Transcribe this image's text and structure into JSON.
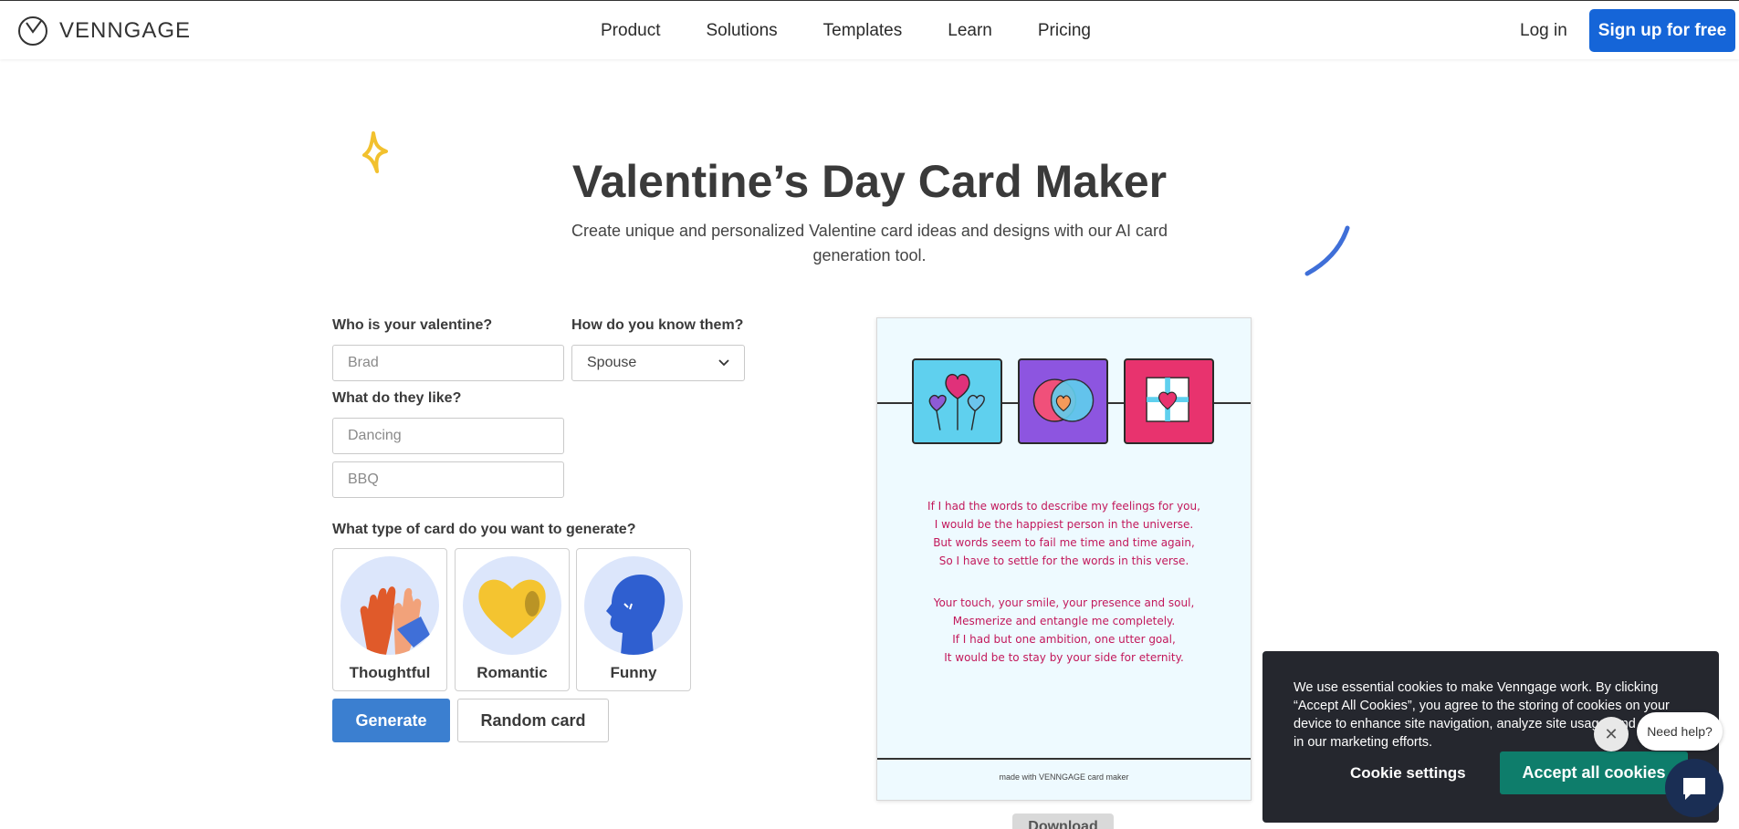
{
  "header": {
    "logo_text": "VENNGAGE",
    "nav": [
      "Product",
      "Solutions",
      "Templates",
      "Learn",
      "Pricing"
    ],
    "login": "Log in",
    "signup": "Sign up for free"
  },
  "hero": {
    "title": "Valentine’s Day Card Maker",
    "subtitle": "Create unique and personalized Valentine card ideas and designs with our AI card generation tool."
  },
  "form": {
    "who_label": "Who is your valentine?",
    "who_placeholder": "Brad",
    "know_label": "How do you know them?",
    "know_value": "Spouse",
    "like_label": "What do they like?",
    "like_placeholder_1": "Dancing",
    "like_placeholder_2": "BBQ",
    "type_label": "What type of card do you want to generate?",
    "types": [
      {
        "label": "Thoughtful",
        "icon": "high-five-icon"
      },
      {
        "label": "Romantic",
        "icon": "heart-icon"
      },
      {
        "label": "Funny",
        "icon": "head-icon"
      }
    ],
    "generate": "Generate",
    "random": "Random card"
  },
  "card": {
    "stanza1": [
      "If I had the words to describe my feelings for you,",
      "I would be the happiest person in the universe.",
      "But words seem to fail me time and time again,",
      "So I have to settle for the words in this verse."
    ],
    "stanza2": [
      "Your touch, your smile, your presence and soul,",
      "Mesmerize and entangle me completely.",
      "If I had but one ambition, one utter goal,",
      "It would be to stay by your side for eternity."
    ],
    "footer": "made with VENNGAGE card maker",
    "download": "Download"
  },
  "cookie": {
    "text": "We use essential cookies to make Venngage work. By clicking “Accept All Cookies”, you agree to the storing of cookies on your device to enhance site navigation, analyze site usage, and assist in our marketing efforts.",
    "settings": "Cookie settings",
    "accept": "Accept all cookies"
  },
  "help": {
    "bubble": "Need help?",
    "close": "✕"
  },
  "colors": {
    "brand_blue": "#1565d8",
    "generate_blue": "#3b7fd0",
    "accept_green": "#0e7d6b",
    "poem_pink": "#c2185b",
    "cookie_bg": "#25272e"
  }
}
